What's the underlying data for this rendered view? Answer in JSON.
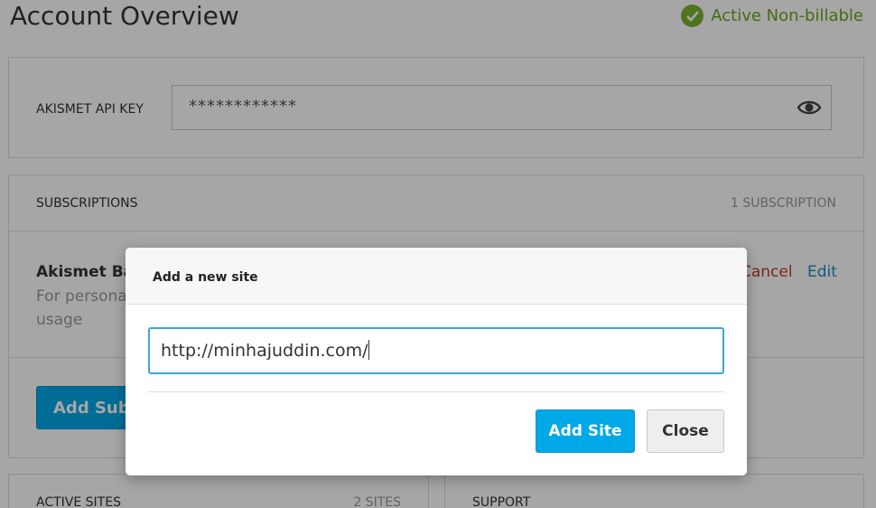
{
  "page": {
    "title": "Account Overview",
    "status": "Active Non-billable"
  },
  "api_key": {
    "label": "AKISMET API KEY",
    "value": "************",
    "reveal_icon": "eye-icon"
  },
  "subscriptions": {
    "title": "SUBSCRIPTIONS",
    "count": "1 SUBSCRIPTION",
    "plan_name": "Akismet Ba",
    "plan_desc": "For persona usage",
    "cancel_label": "Cancel",
    "edit_label": "Edit",
    "add_button": "Add Subs"
  },
  "active_sites": {
    "title": "ACTIVE SITES",
    "count": "2 SITES"
  },
  "support": {
    "title": "SUPPORT"
  },
  "modal": {
    "title": "Add a new site",
    "input_value": "http://minhajuddin.com/",
    "add_button": "Add Site",
    "close_button": "Close"
  },
  "colors": {
    "accent": "#00a8e8",
    "status_green": "#7ab32e",
    "danger": "#c0392b",
    "link": "#1a8ac6"
  }
}
